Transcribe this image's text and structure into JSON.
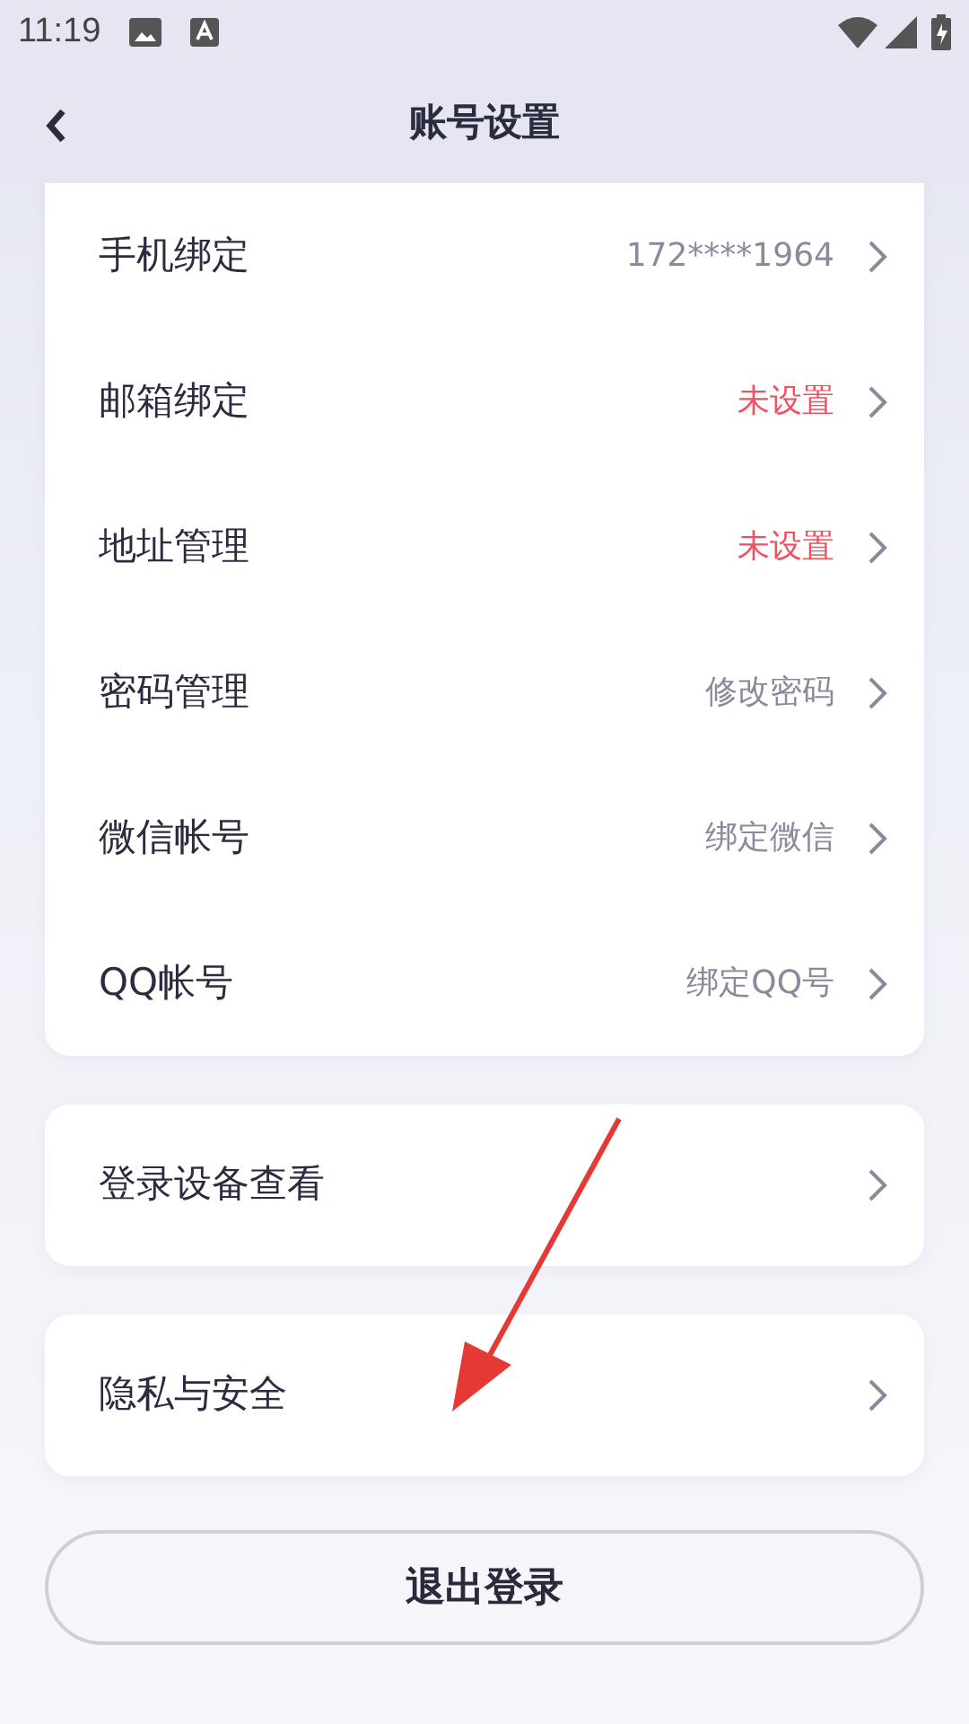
{
  "status_bar": {
    "time": "11:19"
  },
  "header": {
    "title": "账号设置"
  },
  "account_items": [
    {
      "label": "手机绑定",
      "value": "172****1964",
      "color": "#8a8a9c"
    },
    {
      "label": "邮箱绑定",
      "value": "未设置",
      "color": "#f2505f"
    },
    {
      "label": "地址管理",
      "value": "未设置",
      "color": "#f2505f"
    },
    {
      "label": "密码管理",
      "value": "修改密码",
      "color": "#8a8a9c"
    },
    {
      "label": "微信帐号",
      "value": "绑定微信",
      "color": "#8a8a9c"
    },
    {
      "label": "QQ帐号",
      "value": "绑定QQ号",
      "color": "#8a8a9c"
    }
  ],
  "device_item": {
    "label": "登录设备查看"
  },
  "privacy_item": {
    "label": "隐私与安全"
  },
  "logout_button": {
    "label": "退出登录"
  }
}
